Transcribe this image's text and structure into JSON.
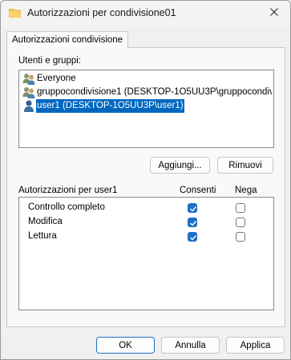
{
  "window": {
    "title": "Autorizzazioni per condivisione01"
  },
  "tabs": [
    {
      "label": "Autorizzazioni condivisione"
    }
  ],
  "users": {
    "label": "Utenti e gruppi:",
    "items": [
      {
        "name": "Everyone",
        "icon": "group-icon",
        "selected": false
      },
      {
        "name": "gruppocondivisione1 (DESKTOP-1O5UU3P\\gruppocondivi...",
        "icon": "group-icon",
        "selected": false
      },
      {
        "name": "user1 (DESKTOP-1O5UU3P\\user1)",
        "icon": "user-icon",
        "selected": true
      }
    ],
    "add_button": "Aggiungi...",
    "remove_button": "Rimuovi"
  },
  "permissions": {
    "label": "Autorizzazioni per user1",
    "allow_header": "Consenti",
    "deny_header": "Nega",
    "rows": [
      {
        "name": "Controllo completo",
        "allow": true,
        "deny": false
      },
      {
        "name": "Modifica",
        "allow": true,
        "deny": false
      },
      {
        "name": "Lettura",
        "allow": true,
        "deny": false
      }
    ]
  },
  "footer": {
    "ok": "OK",
    "cancel": "Annulla",
    "apply": "Applica"
  },
  "colors": {
    "accent": "#0067c0",
    "checkbox": "#1f6fc4"
  }
}
